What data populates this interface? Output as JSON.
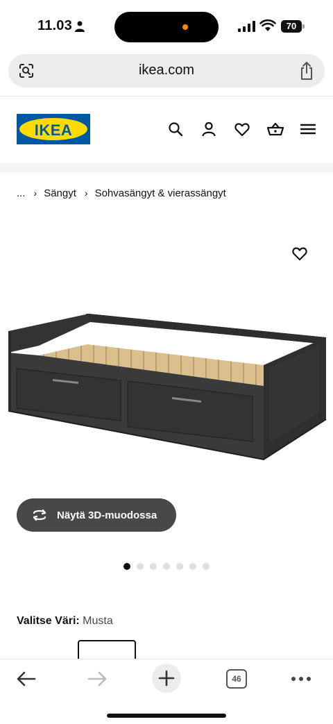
{
  "status": {
    "time": "11.03",
    "battery": "70"
  },
  "browser": {
    "url": "ikea.com",
    "tab_count": "46"
  },
  "brand": {
    "name": "IKEA",
    "blue": "#0058a3",
    "yellow": "#ffdb00"
  },
  "header": {
    "icons": [
      "search-icon",
      "account-icon",
      "heart-icon",
      "basket-icon",
      "menu-icon"
    ]
  },
  "breadcrumb": {
    "ellipsis": "...",
    "items": [
      "Sängyt",
      "Sohvasängyt & vierassängyt"
    ]
  },
  "product": {
    "view_3d_label": "Näytä 3D-muodossa",
    "image_count": 7,
    "active_image_index": 0,
    "color_label": "Valitse Väri:",
    "color_value": "Musta"
  },
  "toolbar": {
    "icons": [
      "back-icon",
      "forward-icon",
      "new-tab-icon",
      "tabs-icon",
      "more-icon"
    ]
  }
}
